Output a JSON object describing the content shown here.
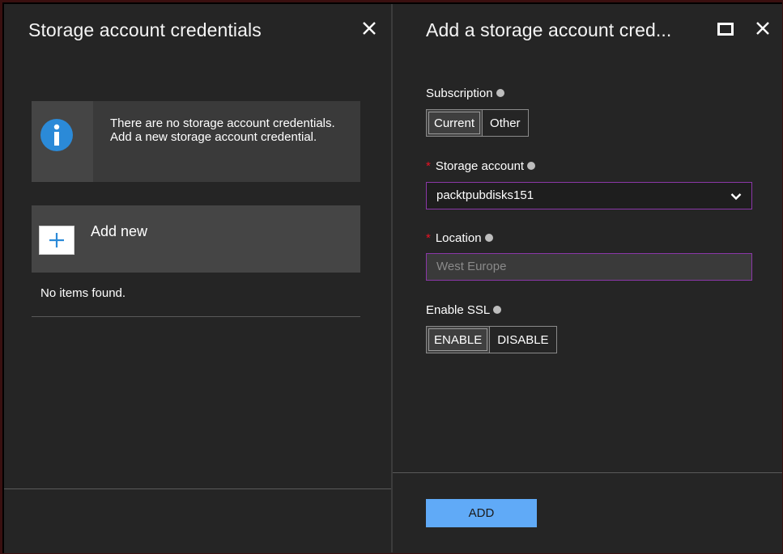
{
  "left_blade": {
    "title": "Storage account credentials",
    "info_message": "There are no storage account credentials. Add a new storage account credential.",
    "add_new_label": "Add new",
    "empty_text": "No items found."
  },
  "right_blade": {
    "title": "Add a storage account cred...",
    "subscription": {
      "label": "Subscription",
      "options": [
        "Current",
        "Other"
      ],
      "selected": "Current"
    },
    "storage_account": {
      "label": "Storage account",
      "required": true,
      "value": "packtpubdisks151"
    },
    "location": {
      "label": "Location",
      "required": true,
      "value": "West Europe"
    },
    "ssl": {
      "label": "Enable SSL",
      "options": [
        "ENABLE",
        "DISABLE"
      ],
      "selected": "ENABLE"
    },
    "add_button_label": "ADD"
  },
  "colors": {
    "background": "#252525",
    "accent_blue": "#60aaf7",
    "info_blue": "#2b8ad8",
    "focus_border": "#8b37a8",
    "required_star": "#e81123"
  },
  "icons": [
    "close-icon",
    "maximize-icon",
    "info-icon",
    "plus-icon",
    "chevron-down-icon"
  ]
}
